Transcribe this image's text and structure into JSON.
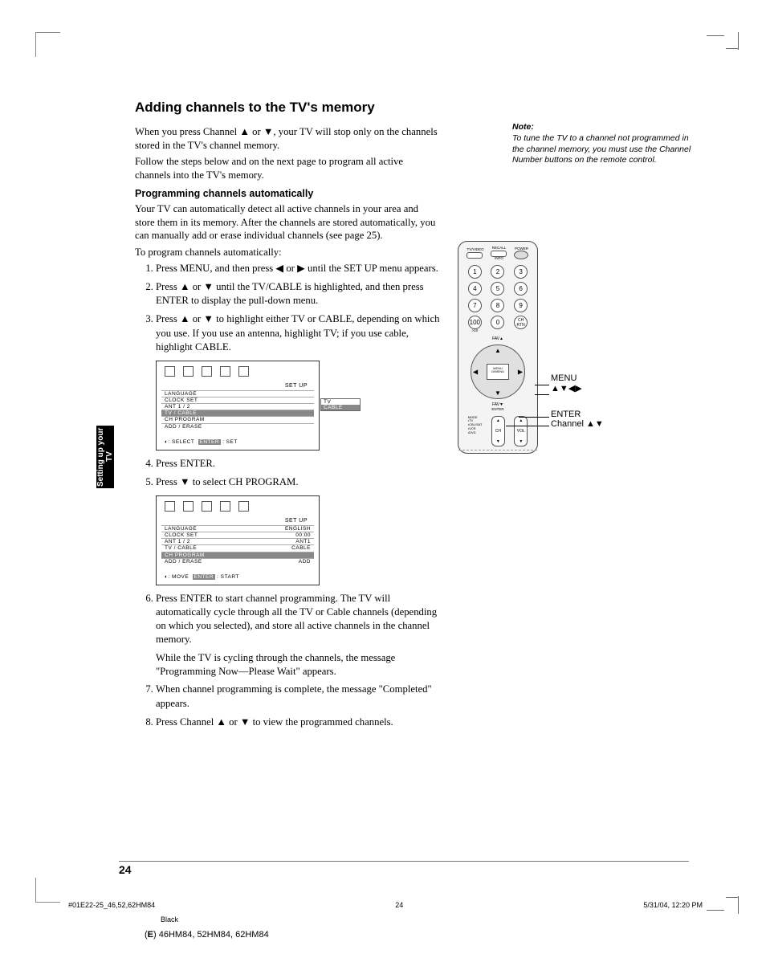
{
  "title": "Adding channels to the TV's memory",
  "para1": "When you press Channel ▲ or ▼, your TV will stop only on the channels stored in the TV's channel memory.",
  "para2": "Follow the steps below and on the next page to program all active channels into the TV's memory.",
  "sub1": "Programming channels automatically",
  "para3": "Your TV can automatically detect all active channels in your area and store them in its memory. After the channels are stored automatically, you can manually add or erase individual channels (see page 25).",
  "para4": "To program channels automatically:",
  "steps1": {
    "1": "Press MENU, and then press ◀ or ▶ until the SET UP menu appears.",
    "2": "Press ▲ or ▼ until the TV/CABLE is highlighted, and then press ENTER to display the pull-down menu.",
    "3": "Press ▲ or ▼ to highlight either TV or CABLE, depending on which you use. If you use an antenna, highlight TV; if you use cable, highlight CABLE."
  },
  "steps2": {
    "4": "Press ENTER.",
    "5": "Press ▼ to select CH PROGRAM."
  },
  "steps3": {
    "6a": "Press ENTER to start channel programming. The TV will automatically cycle through all the TV or Cable channels (depending on which you selected), and store all active channels in the channel memory.",
    "6b": "While the TV is cycling through the channels, the message \"Programming Now—Please Wait\" appears.",
    "7": "When channel programming is complete, the message \"Completed\" appears.",
    "8": "Press Channel ▲ or ▼ to view the programmed channels."
  },
  "note": {
    "head": "Note:",
    "body": "To tune the TV to a channel not programmed in the channel memory, you must use the Channel Number buttons on the remote control."
  },
  "osd": {
    "title": "SET  UP",
    "rows": [
      "LANGUAGE",
      "CLOCK  SET",
      "ANT  1 / 2",
      "TV / CABLE",
      "CH  PROGRAM",
      "ADD / ERASE"
    ],
    "drop1": [
      "TV",
      "CABLE"
    ],
    "foot1_a": ": SELECT",
    "foot1_b": "ENTER",
    "foot1_c": ": SET",
    "rows2": [
      [
        "LANGUAGE",
        "ENGLISH"
      ],
      [
        "CLOCK  SET",
        "00:00"
      ],
      [
        "ANT  1 / 2",
        "ANT1"
      ],
      [
        "TV / CABLE",
        "CABLE"
      ],
      [
        "CH  PROGRAM",
        ""
      ],
      [
        "ADD / ERASE",
        "ADD"
      ]
    ],
    "foot2_a": ": MOVE",
    "foot2_b": "ENTER",
    "foot2_c": ": START"
  },
  "remote": {
    "top": [
      "TV/VIDEO",
      "RECALL",
      "POWER"
    ],
    "info": "INFO",
    "nums": [
      "1",
      "2",
      "3",
      "4",
      "5",
      "6",
      "7",
      "8",
      "9",
      "100",
      "0",
      "CH RTN"
    ],
    "sub10": ">10",
    "fav_up": "FAV▲",
    "fav_dn": "FAV▼",
    "center": "MENU\nO/MENU",
    "enter": "ENTER",
    "mode_head": "MODE",
    "modes": [
      "•TV",
      "•CBL/SAT",
      "•VCR",
      "•DVD"
    ],
    "ch": "CH",
    "vol": "VOL"
  },
  "callouts": {
    "menu": "MENU",
    "arrows": "▲▼◀▶",
    "enter": "ENTER",
    "channel": "Channel ▲▼"
  },
  "sidebar": "Setting up your TV",
  "page_num": "24",
  "footer": {
    "file": "#01E22-25_46,52,62HM84",
    "pg": "24",
    "date": "5/31/04, 12:20 PM",
    "black": "Black",
    "model_prefix": "(E) ",
    "model": "46HM84, 52HM84, 62HM84"
  }
}
